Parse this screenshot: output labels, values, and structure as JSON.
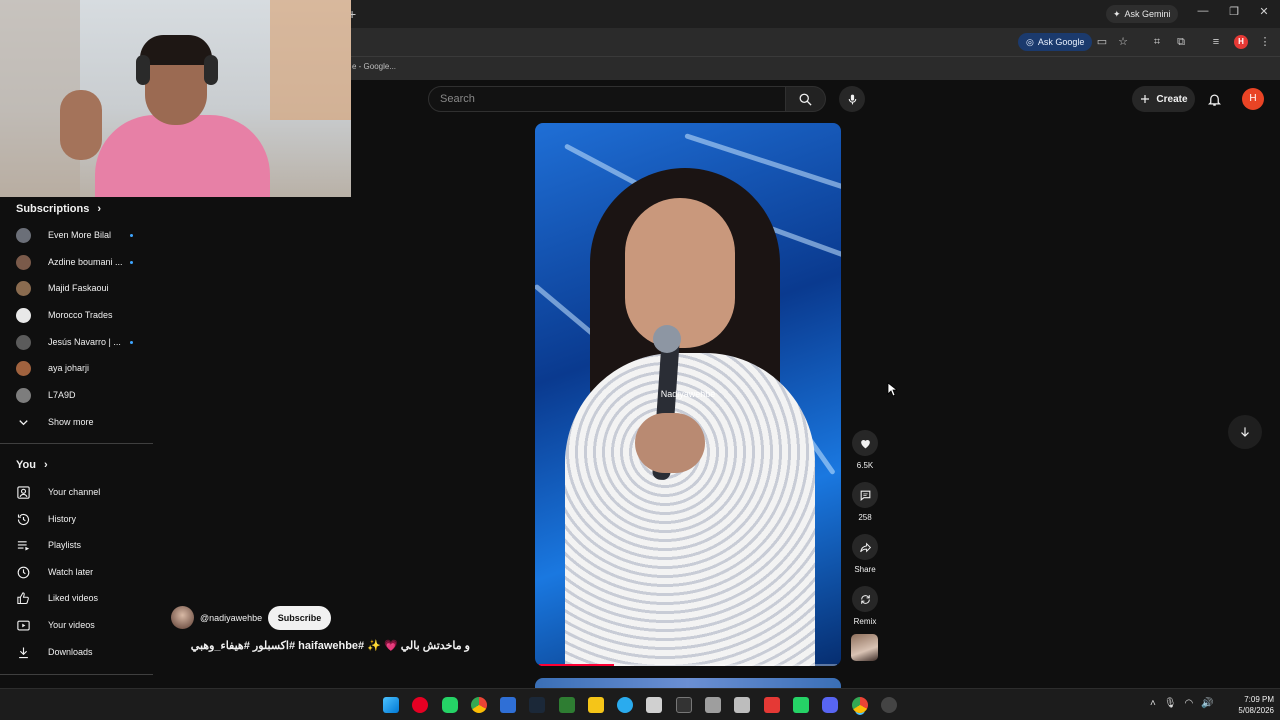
{
  "browser": {
    "new_tab_glyph": "+",
    "ask_gemini_label": "Ask Gemini",
    "ask_google_label": "Ask Google",
    "bookmark_text": "e - Google...",
    "profile_initial": "H"
  },
  "header": {
    "search_placeholder": "Search",
    "create_label": "Create",
    "avatar_initial": "H"
  },
  "sidebar": {
    "subscriptions_title": "Subscriptions",
    "subscriptions": [
      {
        "name": "Even More Bilal",
        "live": true,
        "color": "#6b6f78"
      },
      {
        "name": "Azdine boumani ...",
        "live": true,
        "color": "#7a5a4a"
      },
      {
        "name": "Majid Faskaoui",
        "live": false,
        "color": "#8a6b4f"
      },
      {
        "name": "Morocco Trades",
        "live": false,
        "color": "#e8e8e8"
      },
      {
        "name": "Jesús Navarro | ...",
        "live": true,
        "color": "#5b5b5b"
      },
      {
        "name": "aya joharji",
        "live": false,
        "color": "#a0623e"
      },
      {
        "name": "L7A9D",
        "live": false,
        "color": "#7d7d7d"
      }
    ],
    "show_more_label": "Show more",
    "you_title": "You",
    "you_items": [
      {
        "label": "Your channel",
        "icon": "person-icon"
      },
      {
        "label": "History",
        "icon": "history-icon"
      },
      {
        "label": "Playlists",
        "icon": "playlists-icon"
      },
      {
        "label": "Watch later",
        "icon": "clock-icon"
      },
      {
        "label": "Liked videos",
        "icon": "thumbs-up-icon"
      },
      {
        "label": "Your videos",
        "icon": "play-icon"
      },
      {
        "label": "Downloads",
        "icon": "download-icon"
      }
    ]
  },
  "short": {
    "watermark": "Nadiyawehbe",
    "progress": 0.25,
    "likes": "6.5K",
    "comments": "258",
    "share_label": "Share",
    "remix_label": "Remix"
  },
  "channel": {
    "handle": "@nadiyawehbe",
    "subscribe_label": "Subscribe",
    "caption": "و ماخدتش بالي 💗 ✨ #haifawehbe #اكسبلور #هيفاء_وهبي"
  },
  "taskbar": {
    "time": "7:09 PM",
    "date": "5/08/2026"
  },
  "colors": {
    "accent_red": "#ff0033",
    "live_dot": "#3ea6ff",
    "avatar_bg": "#e94425"
  }
}
